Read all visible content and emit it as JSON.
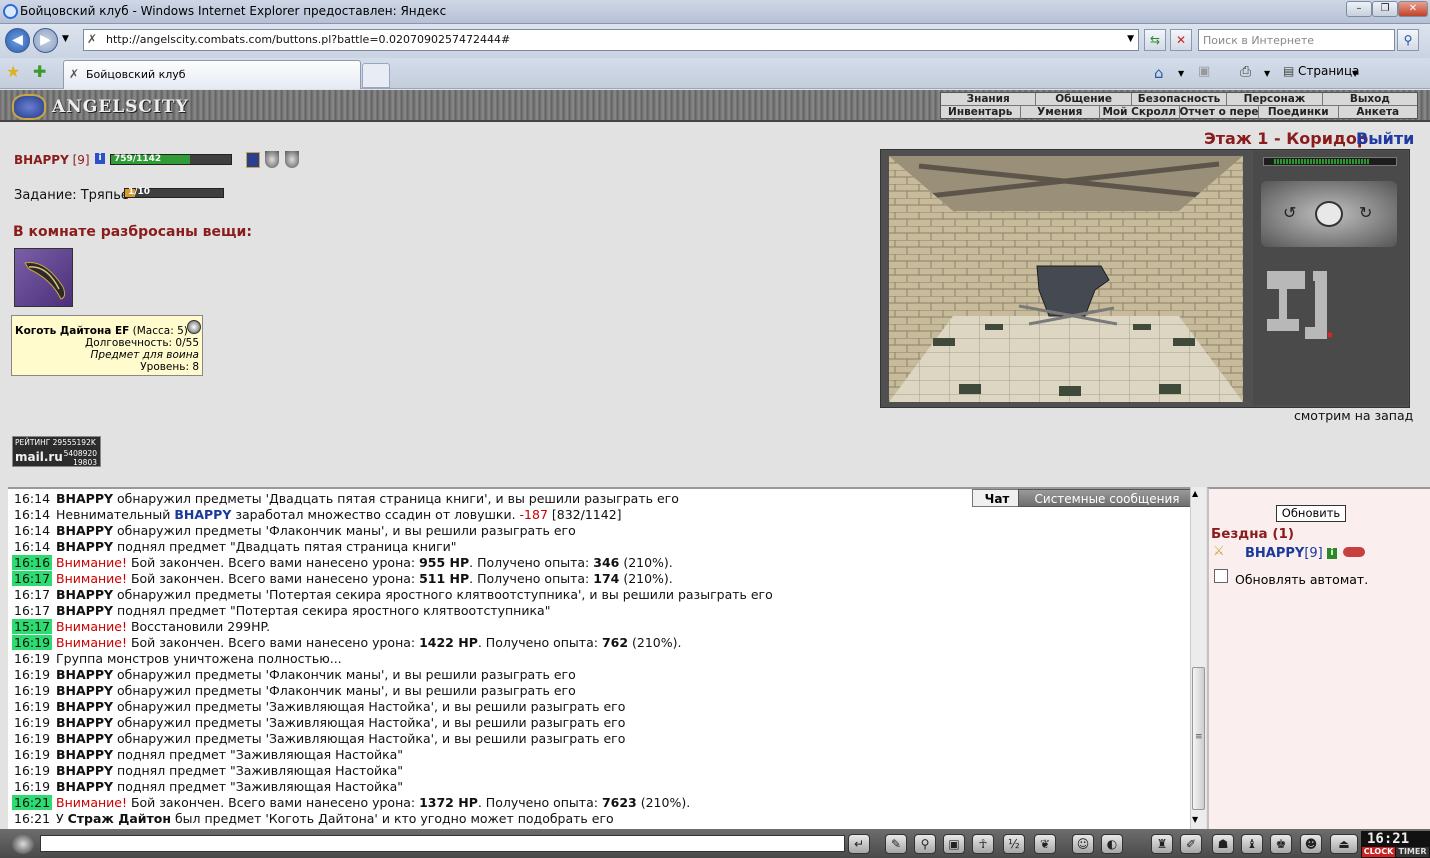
{
  "window": {
    "title": "Бойцовский клуб - Windows Internet Explorer предоставлен: Яндекс"
  },
  "browser": {
    "url": "http://angelscity.combats.com/buttons.pl?battle=0.0207090257472444#",
    "search_placeholder": "Поиск в Интернете",
    "tab_title": "Бойцовский клуб",
    "page_menu": "Страница"
  },
  "game": {
    "logo": "ANGELSCITY",
    "menu_top": [
      "Знания",
      "Общение",
      "Безопасность",
      "Персонаж",
      "Выход"
    ],
    "menu_bottom": [
      "Инвентарь",
      "Умения",
      "Мой Скролл",
      "Отчет о переводах",
      "Поединки",
      "Анкета"
    ],
    "location": "Этаж 1 - Коридор",
    "exit_label": "Выйти",
    "player": {
      "name": "BHAPPY",
      "level": "[9]",
      "hp": "759/1142",
      "hp_fraction": 0.66
    },
    "quest": {
      "label": "Задание: Тряпье",
      "progress": "1/10",
      "fraction": 0.1
    },
    "items_heading": "В комнате разбросаны вещи:",
    "item": {
      "name": "Коготь Дайтона EF",
      "mass": "(Масса: 5)",
      "durability": "Долговечность: 0/55",
      "class": "Предмет для воина",
      "level": "Уровень: 8"
    },
    "direction": "смотрим на запад",
    "rating": {
      "line1": "РЕЙТИНГ 29555192K",
      "brand": "mail.ru",
      "n1": "5408920",
      "n2": "19803"
    }
  },
  "chat": {
    "tabs": [
      "Чат",
      "Системные сообщения"
    ],
    "lines": [
      {
        "time": "16:14",
        "hl": false,
        "parts": [
          [
            "b",
            "BHAPPY"
          ],
          [
            "t",
            " обнаружил предметы 'Двадцать пятая страница книги', и вы решили разыграть его"
          ]
        ]
      },
      {
        "time": "16:14",
        "hl": false,
        "parts": [
          [
            "t",
            "Невнимательный "
          ],
          [
            "u",
            "BHAPPY"
          ],
          [
            "t",
            " заработал множество ссадин от ловушки. "
          ],
          [
            "r",
            "-187"
          ],
          [
            "t",
            " [832/1142]"
          ]
        ]
      },
      {
        "time": "16:14",
        "hl": false,
        "parts": [
          [
            "b",
            "BHAPPY"
          ],
          [
            "t",
            " обнаружил предметы 'Флакончик маны', и вы решили разыграть его"
          ]
        ]
      },
      {
        "time": "16:14",
        "hl": false,
        "parts": [
          [
            "b",
            "BHAPPY"
          ],
          [
            "t",
            " поднял предмет \"Двадцать пятая страница книги\""
          ]
        ]
      },
      {
        "time": "16:16",
        "hl": true,
        "parts": [
          [
            "r",
            "Внимание!"
          ],
          [
            "t",
            " Бой закончен. Всего вами нанесено урона: "
          ],
          [
            "b",
            "955 HP"
          ],
          [
            "t",
            ". Получено опыта: "
          ],
          [
            "b",
            "346"
          ],
          [
            "t",
            " (210%)."
          ]
        ]
      },
      {
        "time": "16:17",
        "hl": true,
        "parts": [
          [
            "r",
            "Внимание!"
          ],
          [
            "t",
            " Бой закончен. Всего вами нанесено урона: "
          ],
          [
            "b",
            "511 HP"
          ],
          [
            "t",
            ". Получено опыта: "
          ],
          [
            "b",
            "174"
          ],
          [
            "t",
            " (210%)."
          ]
        ]
      },
      {
        "time": "16:17",
        "hl": false,
        "parts": [
          [
            "b",
            "BHAPPY"
          ],
          [
            "t",
            " обнаружил предметы 'Потертая секира яростного клятвоотступника', и вы решили разыграть его"
          ]
        ]
      },
      {
        "time": "16:17",
        "hl": false,
        "parts": [
          [
            "b",
            "BHAPPY"
          ],
          [
            "t",
            " поднял предмет \"Потертая секира яростного клятвоотступника\""
          ]
        ]
      },
      {
        "time": "15:17",
        "hl": true,
        "parts": [
          [
            "r",
            "Внимание!"
          ],
          [
            "t",
            " Восстановили 299HP."
          ]
        ]
      },
      {
        "time": "16:19",
        "hl": true,
        "parts": [
          [
            "r",
            "Внимание!"
          ],
          [
            "t",
            " Бой закончен. Всего вами нанесено урона: "
          ],
          [
            "b",
            "1422 HP"
          ],
          [
            "t",
            ". Получено опыта: "
          ],
          [
            "b",
            "762"
          ],
          [
            "t",
            " (210%)."
          ]
        ]
      },
      {
        "time": "16:19",
        "hl": false,
        "parts": [
          [
            "t",
            "Группа монстров уничтожена полностью..."
          ]
        ]
      },
      {
        "time": "16:19",
        "hl": false,
        "parts": [
          [
            "b",
            "BHAPPY"
          ],
          [
            "t",
            " обнаружил предметы 'Флакончик маны', и вы решили разыграть его"
          ]
        ]
      },
      {
        "time": "16:19",
        "hl": false,
        "parts": [
          [
            "b",
            "BHAPPY"
          ],
          [
            "t",
            " обнаружил предметы 'Флакончик маны', и вы решили разыграть его"
          ]
        ]
      },
      {
        "time": "16:19",
        "hl": false,
        "parts": [
          [
            "b",
            "BHAPPY"
          ],
          [
            "t",
            " обнаружил предметы 'Заживляющая Настойка', и вы решили разыграть его"
          ]
        ]
      },
      {
        "time": "16:19",
        "hl": false,
        "parts": [
          [
            "b",
            "BHAPPY"
          ],
          [
            "t",
            " обнаружил предметы 'Заживляющая Настойка', и вы решили разыграть его"
          ]
        ]
      },
      {
        "time": "16:19",
        "hl": false,
        "parts": [
          [
            "b",
            "BHAPPY"
          ],
          [
            "t",
            " обнаружил предметы 'Заживляющая Настойка', и вы решили разыграть его"
          ]
        ]
      },
      {
        "time": "16:19",
        "hl": false,
        "parts": [
          [
            "b",
            "BHAPPY"
          ],
          [
            "t",
            " поднял предмет \"Заживляющая Настойка\""
          ]
        ]
      },
      {
        "time": "16:19",
        "hl": false,
        "parts": [
          [
            "b",
            "BHAPPY"
          ],
          [
            "t",
            " поднял предмет \"Заживляющая Настойка\""
          ]
        ]
      },
      {
        "time": "16:19",
        "hl": false,
        "parts": [
          [
            "b",
            "BHAPPY"
          ],
          [
            "t",
            " поднял предмет \"Заживляющая Настойка\""
          ]
        ]
      },
      {
        "time": "16:21",
        "hl": true,
        "parts": [
          [
            "r",
            "Внимание!"
          ],
          [
            "t",
            " Бой закончен. Всего вами нанесено урона: "
          ],
          [
            "b",
            "1372 HP"
          ],
          [
            "t",
            ". Получено опыта: "
          ],
          [
            "b",
            "7623"
          ],
          [
            "t",
            " (210%)."
          ]
        ]
      },
      {
        "time": "16:21",
        "hl": false,
        "parts": [
          [
            "t",
            "У "
          ],
          [
            "b",
            "Страж Дайтон"
          ],
          [
            "t",
            " был предмет 'Коготь Дайтона' и кто угодно может подобрать его"
          ]
        ]
      }
    ]
  },
  "online": {
    "refresh_label": "Обновить",
    "room": "Бездна (1)",
    "user_name": "BHAPPY",
    "user_level": "[9]",
    "auto_refresh_label": "Обновлять автомат.",
    "auto_refresh_checked": false
  },
  "bottom": {
    "clock_time": "16:21",
    "clock_label": "CLOCK",
    "timer_label": "TIMER"
  }
}
